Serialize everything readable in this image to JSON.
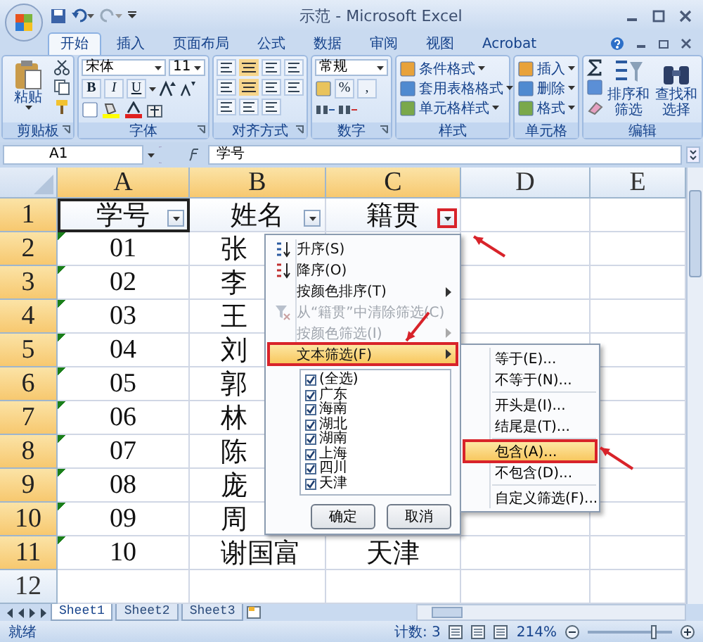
{
  "window": {
    "title": "示范 - Microsoft Excel"
  },
  "tabs": [
    {
      "label": "开始",
      "selected": true
    },
    {
      "label": "插入",
      "selected": false
    },
    {
      "label": "页面布局",
      "selected": false
    },
    {
      "label": "公式",
      "selected": false
    },
    {
      "label": "数据",
      "selected": false
    },
    {
      "label": "审阅",
      "selected": false
    },
    {
      "label": "视图",
      "selected": false
    },
    {
      "label": "Acrobat",
      "selected": false
    }
  ],
  "ribbon": {
    "groups": [
      {
        "kind": "clipboard",
        "label": "剪贴板",
        "launcher": true,
        "paste": "粘贴"
      },
      {
        "kind": "font",
        "label": "字体",
        "launcher": true,
        "font_name": "宋体",
        "font_size": "11",
        "buttons": [
          "B",
          "I",
          "U"
        ]
      },
      {
        "kind": "align",
        "label": "对齐方式",
        "launcher": true
      },
      {
        "kind": "number",
        "label": "数字",
        "launcher": true,
        "format": "常规",
        "buttons": [
          "%",
          ","
        ]
      },
      {
        "kind": "list",
        "label": "样式",
        "launcher": false,
        "items": [
          "条件格式",
          "套用表格格式",
          "单元格样式"
        ]
      },
      {
        "kind": "list",
        "label": "单元格",
        "launcher": false,
        "items": [
          "插入",
          "删除",
          "格式"
        ]
      },
      {
        "kind": "edit",
        "label": "编辑",
        "launcher": false,
        "items": [
          "排序和筛选",
          "查找和选择"
        ]
      }
    ]
  },
  "formula_bar": {
    "name_box": "A1",
    "formula": "学号"
  },
  "sheet": {
    "columns": [
      {
        "label": "A",
        "highlighted": true
      },
      {
        "label": "B",
        "highlighted": true
      },
      {
        "label": "C",
        "highlighted": true
      },
      {
        "label": "D",
        "highlighted": false
      },
      {
        "label": "E",
        "highlighted": false
      }
    ],
    "rows": [
      {
        "label": "1",
        "highlighted": true,
        "kind": "header",
        "cells": [
          {
            "text": "学号",
            "annotated": false
          },
          {
            "text": "姓名",
            "annotated": false
          },
          {
            "text": "籍贯",
            "annotated": true
          }
        ]
      },
      {
        "label": "2",
        "highlighted": true,
        "kind": "data",
        "flagged": true,
        "cells": [
          "01",
          "张"
        ]
      },
      {
        "label": "3",
        "highlighted": true,
        "kind": "data",
        "flagged": true,
        "cells": [
          "02",
          "李"
        ]
      },
      {
        "label": "4",
        "highlighted": true,
        "kind": "data",
        "flagged": true,
        "cells": [
          "03",
          "王"
        ]
      },
      {
        "label": "5",
        "highlighted": true,
        "kind": "data",
        "flagged": true,
        "cells": [
          "04",
          "刘"
        ]
      },
      {
        "label": "6",
        "highlighted": true,
        "kind": "data",
        "flagged": true,
        "cells": [
          "05",
          "郭"
        ]
      },
      {
        "label": "7",
        "highlighted": true,
        "kind": "data",
        "flagged": true,
        "cells": [
          "06",
          "林"
        ]
      },
      {
        "label": "8",
        "highlighted": true,
        "kind": "data",
        "flagged": true,
        "cells": [
          "07",
          "陈"
        ]
      },
      {
        "label": "9",
        "highlighted": true,
        "kind": "data",
        "flagged": true,
        "cells": [
          "08",
          "庞"
        ]
      },
      {
        "label": "10",
        "highlighted": true,
        "kind": "data",
        "flagged": true,
        "cells": [
          "09",
          "周"
        ]
      },
      {
        "label": "11",
        "highlighted": true,
        "kind": "data",
        "flagged": true,
        "cells": [
          "10",
          "谢国富",
          "天津"
        ]
      },
      {
        "label": "12",
        "highlighted": false,
        "kind": "data",
        "flagged": false
      }
    ]
  },
  "filter_menu": {
    "items": [
      {
        "label": "升序(S)",
        "kind": "sort_asc",
        "disabled": false,
        "submenu": false,
        "annotated": false
      },
      {
        "label": "降序(O)",
        "kind": "sort_desc",
        "disabled": false,
        "submenu": false,
        "annotated": false
      },
      {
        "label": "按颜色排序(T)",
        "kind": "plain",
        "disabled": false,
        "submenu": true,
        "annotated": false
      },
      {
        "label": "从“籍贯”中清除筛选(C)",
        "kind": "clear",
        "disabled": true,
        "submenu": false,
        "annotated": false
      },
      {
        "label": "按颜色筛选(I)",
        "kind": "plain",
        "disabled": true,
        "submenu": true,
        "annotated": false
      },
      {
        "label": "文本筛选(F)",
        "kind": "plain",
        "disabled": false,
        "submenu": true,
        "annotated": true
      }
    ],
    "values": [
      {
        "label": "(全选)",
        "checked": true
      },
      {
        "label": "广东",
        "checked": true
      },
      {
        "label": "海南",
        "checked": true
      },
      {
        "label": "湖北",
        "checked": true
      },
      {
        "label": "湖南",
        "checked": true
      },
      {
        "label": "上海",
        "checked": true
      },
      {
        "label": "四川",
        "checked": true
      },
      {
        "label": "天津",
        "checked": true
      }
    ],
    "buttons": [
      "确定",
      "取消"
    ]
  },
  "submenu": {
    "items": [
      {
        "label": "等于(E)...",
        "separator_before": false,
        "annotated": false
      },
      {
        "label": "不等于(N)...",
        "separator_before": false,
        "annotated": false
      },
      {
        "label": "开头是(I)...",
        "separator_before": true,
        "annotated": false
      },
      {
        "label": "结尾是(T)...",
        "separator_before": false,
        "annotated": false
      },
      {
        "label": "包含(A)...",
        "separator_before": true,
        "annotated": true
      },
      {
        "label": "不包含(D)...",
        "separator_before": false,
        "annotated": false
      },
      {
        "label": "自定义筛选(F)...",
        "separator_before": true,
        "annotated": false
      }
    ]
  },
  "sheet_tabs": [
    {
      "label": "Sheet1",
      "selected": true
    },
    {
      "label": "Sheet2",
      "selected": false
    },
    {
      "label": "Sheet3",
      "selected": false
    }
  ],
  "status_bar": {
    "status": "就绪",
    "count": "计数: 3",
    "zoom": "214%",
    "zoom_slider": {
      "level": 0.78
    }
  }
}
